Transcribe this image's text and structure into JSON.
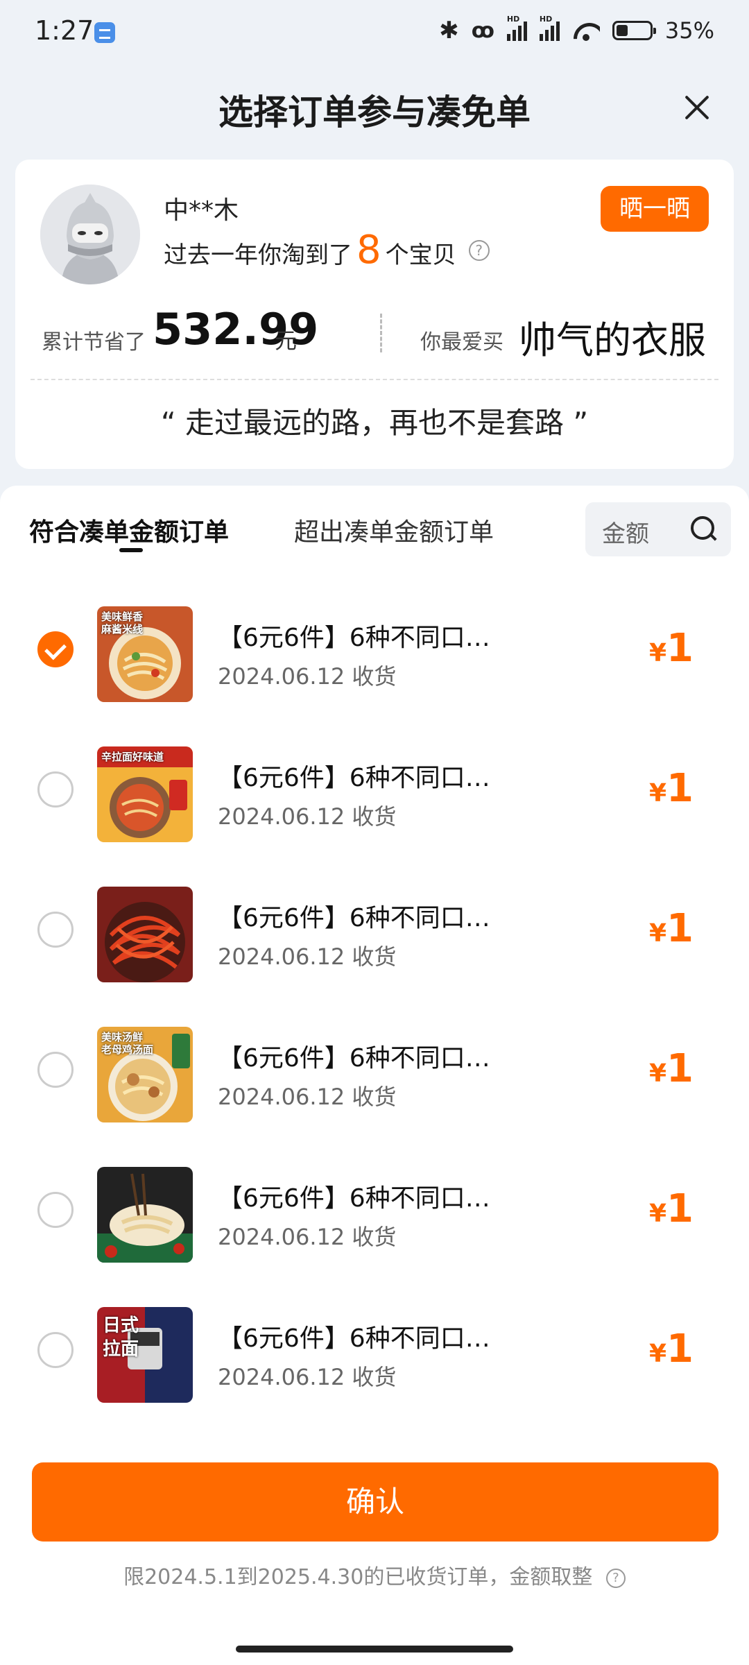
{
  "status_bar": {
    "time": "1:27",
    "battery": "35%"
  },
  "header": {
    "title": "选择订单参与凑免单"
  },
  "profile": {
    "username": "中**木",
    "bought_prefix": "过去一年你淘到了",
    "bought_count": "8",
    "bought_suffix": "个宝贝",
    "share_label": "晒一晒",
    "saved_label": "累计节省了",
    "saved_amount": "532.99",
    "saved_unit": "元",
    "favorite_label": "你最爱买",
    "favorite_value": "帅气的衣服",
    "quote": "“ 走过最远的路，再也不是套路 ”"
  },
  "tabs": {
    "active": "符合凑单金额订单",
    "other": "超出凑单金额订单"
  },
  "search": {
    "placeholder": "金额"
  },
  "orders": [
    {
      "title": "【6元6件】6种不同口…",
      "date": "2024.06.12 收货",
      "currency": "¥",
      "price": "1",
      "checked": true,
      "thumb_label": "美味鲜香\n麻酱米线"
    },
    {
      "title": "【6元6件】6种不同口…",
      "date": "2024.06.12 收货",
      "currency": "¥",
      "price": "1",
      "checked": false,
      "thumb_label": "辛拉面好味道"
    },
    {
      "title": "【6元6件】6种不同口…",
      "date": "2024.06.12 收货",
      "currency": "¥",
      "price": "1",
      "checked": false,
      "thumb_label": ""
    },
    {
      "title": "【6元6件】6种不同口…",
      "date": "2024.06.12 收货",
      "currency": "¥",
      "price": "1",
      "checked": false,
      "thumb_label": "美味汤鲜\n老母鸡汤面"
    },
    {
      "title": "【6元6件】6种不同口…",
      "date": "2024.06.12 收货",
      "currency": "¥",
      "price": "1",
      "checked": false,
      "thumb_label": ""
    },
    {
      "title": "【6元6件】6种不同口…",
      "date": "2024.06.12 收货",
      "currency": "¥",
      "price": "1",
      "checked": false,
      "thumb_label": "日式\n拉面"
    }
  ],
  "footer": {
    "confirm_label": "确认",
    "note": "限2024.5.1到2025.4.30的已收货订单，金额取整"
  },
  "colors": {
    "accent": "#ff6a00",
    "background": "#eef2f7"
  }
}
